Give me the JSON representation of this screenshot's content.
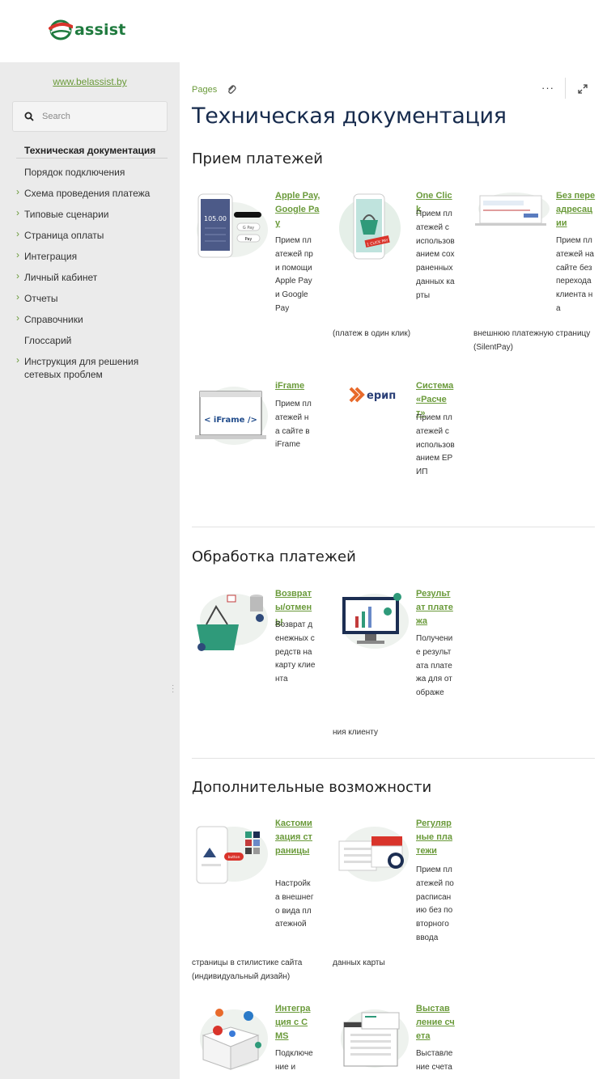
{
  "header": {
    "logo_text": "assist"
  },
  "sidebar": {
    "site_link": "www.belassist.by",
    "search_placeholder": "Search",
    "items": [
      {
        "label": "Техническая документация",
        "chevron": false,
        "active": true
      },
      {
        "label": "Порядок подключения",
        "chevron": false
      },
      {
        "label": "Схема проведения платежа",
        "chevron": true
      },
      {
        "label": "Типовые сценарии",
        "chevron": true
      },
      {
        "label": "Страница оплаты",
        "chevron": true
      },
      {
        "label": "Интеграция",
        "chevron": true
      },
      {
        "label": "Личный кабинет",
        "chevron": true
      },
      {
        "label": "Отчеты",
        "chevron": true
      },
      {
        "label": "Справочники",
        "chevron": true
      },
      {
        "label": "Глоссарий",
        "chevron": false
      },
      {
        "label": "Инструкция для решения сетевых проблем",
        "chevron": true
      }
    ]
  },
  "toolbar": {
    "breadcrumb": "Pages",
    "more": "···"
  },
  "page": {
    "title": "Техническая документация"
  },
  "sections": [
    {
      "heading": "Прием платежей",
      "cards": [
        {
          "title": "Apple Pay, Google Pay",
          "desc": "Прием платежей при помощи Apple Pay и Google Pay",
          "tail": "",
          "icon": "phone-pay-icon",
          "amount": "105.00"
        },
        {
          "title": "One Click",
          "desc": "Прием платежей с использованием сохраненных данных карты",
          "tail": "(платеж в один клик)",
          "icon": "basket-phone-icon",
          "badge": "1 CLICK PAY"
        },
        {
          "title": "Без переадресации",
          "desc": "Прием платежей на сайте без перехода клиента на",
          "tail": "внешнюю платежную страницу (SilentPay)",
          "icon": "laptop-form-icon"
        },
        {
          "title": "iFrame",
          "desc": "Прием платежей на сайте в iFrame",
          "tail": "",
          "icon": "iframe-icon",
          "code": "< iFrame />"
        },
        {
          "title": "Система «Расчет»",
          "desc": "Прием платежей с использованием ЕРИП",
          "tail": "",
          "icon": "erip-icon",
          "logo": "ерип"
        }
      ]
    },
    {
      "heading": "Обработка платежей",
      "cards": [
        {
          "title": "Возвраты/отмены",
          "desc": "Возврат денежных средств на карту клиента",
          "tail": "",
          "icon": "refund-basket-icon"
        },
        {
          "title": "Результат платежа",
          "desc": "Получение результата платежа для отображе",
          "tail": "ния клиенту",
          "icon": "monitor-chart-icon"
        }
      ]
    },
    {
      "heading": "Дополнительные возможности",
      "cards": [
        {
          "title": "Кастомизация страницы",
          "desc": "Настройка внешнего вида платежной",
          "tail": "страницы в стилистике сайта (индивидуальный дизайн)",
          "icon": "customize-phone-icon",
          "button": "button"
        },
        {
          "title": "Регулярные платежи",
          "desc": "Прием платежей по расписанию без повторного ввода",
          "tail": "данных карты",
          "icon": "calendar-clock-icon"
        },
        {
          "title": "Интеграция с CMS",
          "desc": "Подключение и",
          "tail": "",
          "icon": "cms-box-icon"
        },
        {
          "title": "Выставление счета",
          "desc": "Выставление счета",
          "tail": "",
          "icon": "invoice-icon"
        }
      ]
    }
  ],
  "colors": {
    "accent": "#6a9a3a",
    "brand_red": "#d9342b",
    "brand_green": "#1f7a3e",
    "sidebar_bg": "#ebebeb",
    "title": "#172b4d"
  }
}
